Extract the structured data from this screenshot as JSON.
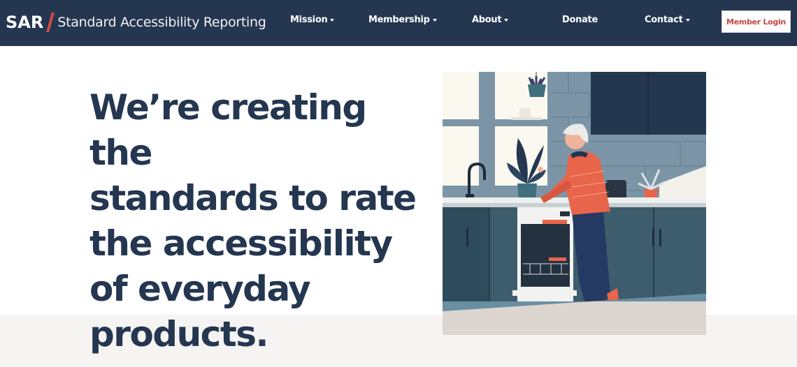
{
  "brand": {
    "abbr": "SAR",
    "name": "Standard Accessibility Reporting",
    "accent_color": "#d24a43"
  },
  "nav": {
    "items": [
      {
        "label": "Mission",
        "has_dropdown": true
      },
      {
        "label": "Membership",
        "has_dropdown": true
      },
      {
        "label": "About",
        "has_dropdown": true
      },
      {
        "label": "Donate",
        "has_dropdown": false
      },
      {
        "label": "Contact",
        "has_dropdown": true
      }
    ],
    "login_label": "Member Login",
    "background_color": "#243650"
  },
  "hero": {
    "headline_lines": [
      "We’re creating the",
      "standards to rate",
      "the accessibility",
      "of everyday",
      "products."
    ],
    "image_alt": "Illustration of an elderly woman in an orange sweater using a dishwasher in a kitchen"
  }
}
